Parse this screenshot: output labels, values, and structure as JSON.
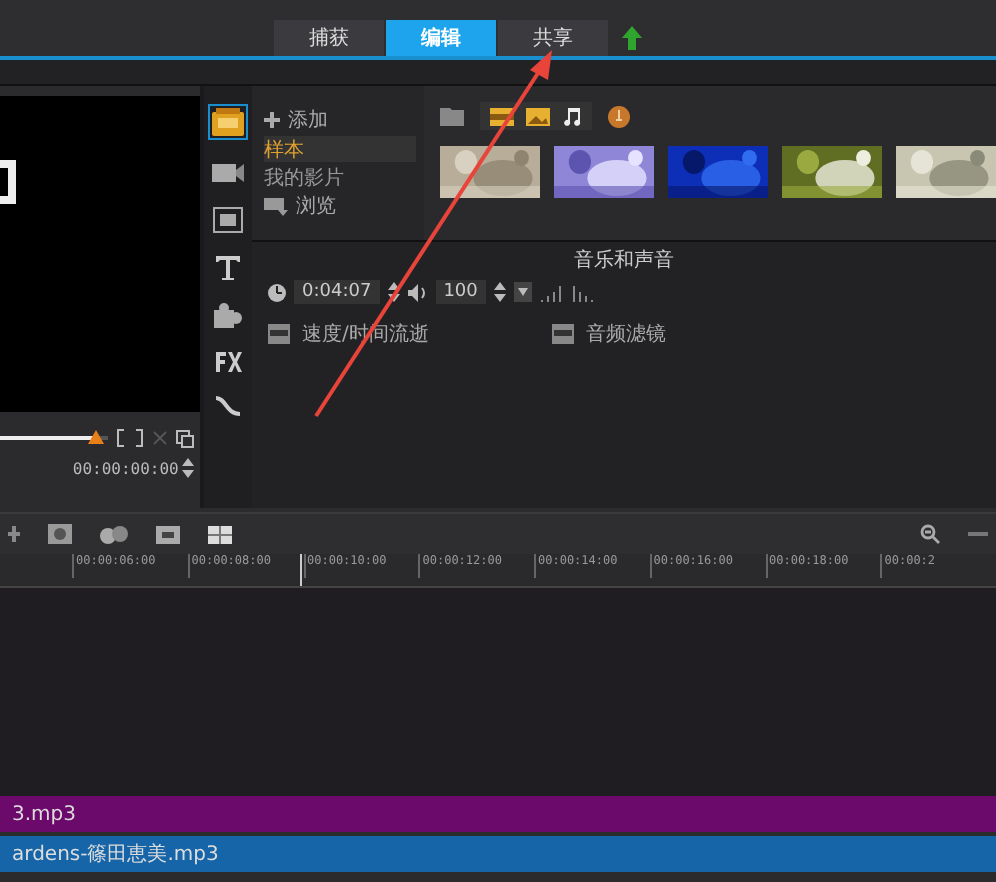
{
  "tabs": [
    {
      "label": "捕获",
      "selected": false
    },
    {
      "label": "编辑",
      "selected": true
    },
    {
      "label": "共享",
      "selected": false
    }
  ],
  "preview": {
    "timecode": "00:00:00:00",
    "level": 0.88
  },
  "library": {
    "add_label": "添加",
    "items": [
      {
        "label": "样本",
        "selected": true
      },
      {
        "label": "我的影片",
        "selected": false
      }
    ],
    "browse_label": "浏览"
  },
  "options": {
    "section_title": "音乐和声音",
    "duration": "0:04:07",
    "volume": "100",
    "buttons": [
      "速度/时间流逝",
      "音频滤镜"
    ]
  },
  "timeline": {
    "ticks": [
      "00:00:06:00",
      "00:00:08:00",
      "00:00:10:00",
      "00:00:12:00",
      "00:00:14:00",
      "00:00:16:00",
      "00:00:18:00",
      "00:00:2"
    ],
    "tracks": [
      {
        "label": "3.mp3",
        "color": "#6c0a6c"
      },
      {
        "label": "ardens-篠田恵美.mp3",
        "color": "#1565a8"
      }
    ]
  }
}
